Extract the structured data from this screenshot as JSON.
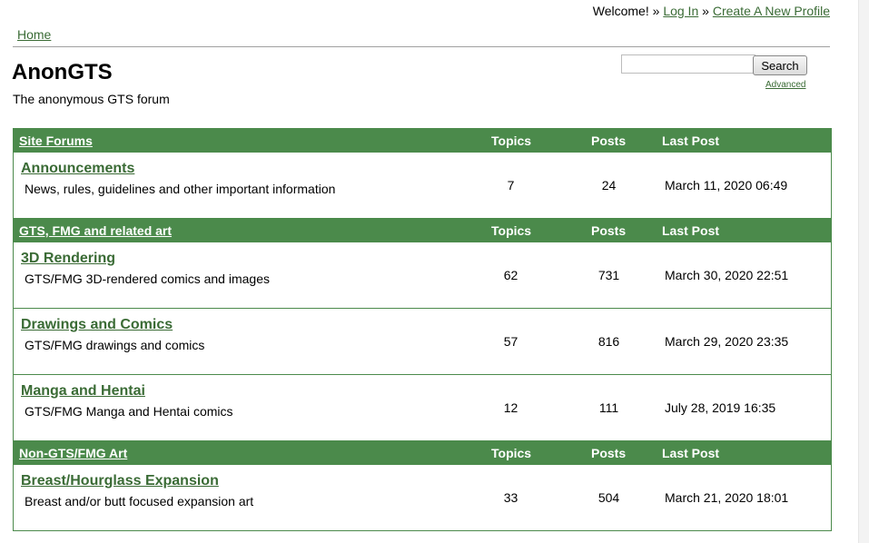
{
  "header": {
    "welcome": "Welcome! »",
    "login": "Log In",
    "separator": "»",
    "create_profile": "Create A New Profile"
  },
  "breadcrumb": {
    "home": "Home"
  },
  "site": {
    "title": "AnonGTS",
    "subtitle": "The anonymous GTS forum"
  },
  "search": {
    "value": "",
    "button": "Search",
    "advanced": "Advanced"
  },
  "columns": {
    "topics": "Topics",
    "posts": "Posts",
    "last_post": "Last Post"
  },
  "categories": [
    {
      "name": "Site Forums",
      "forums": [
        {
          "name": "Announcements",
          "desc": "News, rules, guidelines and other important information",
          "topics": "7",
          "posts": "24",
          "last": "March 11, 2020 06:49"
        }
      ]
    },
    {
      "name": "GTS, FMG and related art",
      "forums": [
        {
          "name": "3D Rendering",
          "desc": "GTS/FMG 3D-rendered comics and images",
          "topics": "62",
          "posts": "731",
          "last": "March 30, 2020 22:51"
        },
        {
          "name": "Drawings and Comics",
          "desc": "GTS/FMG drawings and comics",
          "topics": "57",
          "posts": "816",
          "last": "March 29, 2020 23:35"
        },
        {
          "name": "Manga and Hentai",
          "desc": "GTS/FMG Manga and Hentai comics",
          "topics": "12",
          "posts": "111",
          "last": "July 28, 2019 16:35"
        }
      ]
    },
    {
      "name": "Non-GTS/FMG Art",
      "forums": [
        {
          "name": "Breast/Hourglass Expansion",
          "desc": "Breast and/or butt focused expansion art",
          "topics": "33",
          "posts": "504",
          "last": "March 21, 2020 18:01"
        }
      ]
    }
  ]
}
